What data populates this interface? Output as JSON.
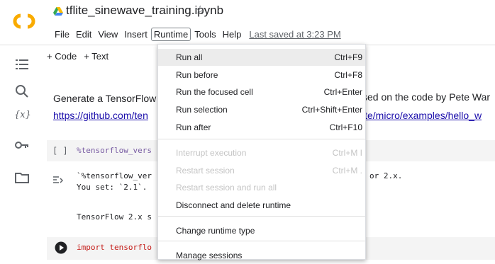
{
  "header": {
    "notebook_title": "tflite_sinewave_training.ipynb",
    "star_glyph": "☆",
    "menu": [
      "File",
      "Edit",
      "View",
      "Insert",
      "Runtime",
      "Tools",
      "Help"
    ],
    "active_menu": "Runtime",
    "last_saved": "Last saved at 3:23 PM"
  },
  "rail": {
    "variables_label": "{x}"
  },
  "toolbar": {
    "code_btn": "+ Code",
    "text_btn": "+ Text"
  },
  "content": {
    "text_line1": "Generate a TensorFlow",
    "link_line": "https://github.com/ten",
    "right_text": "sed on the code by Pete War",
    "right_link": "ite/micro/examples/hello_w",
    "cell1_bracket": "[ ]",
    "cell1_code": "%tensorflow_vers",
    "out_line1": "`%tensorflow_ver",
    "out_line2": "You set: `2.1`. ",
    "out_right": "or 2.x.",
    "out_line3": "TensorFlow 2.x s",
    "cell2_code1": "import tensorflo"
  },
  "runtime_menu": {
    "items": [
      {
        "label": "Run all",
        "shortcut": "Ctrl+F9",
        "disabled": false,
        "highlighted": true
      },
      {
        "label": "Run before",
        "shortcut": "Ctrl+F8",
        "disabled": false,
        "highlighted": false
      },
      {
        "label": "Run the focused cell",
        "shortcut": "Ctrl+Enter",
        "disabled": false,
        "highlighted": false
      },
      {
        "label": "Run selection",
        "shortcut": "Ctrl+Shift+Enter",
        "disabled": false,
        "highlighted": false
      },
      {
        "label": "Run after",
        "shortcut": "Ctrl+F10",
        "disabled": false,
        "highlighted": false
      },
      {
        "label": "Interrupt execution",
        "shortcut": "Ctrl+M I",
        "disabled": true,
        "highlighted": false
      },
      {
        "label": "Restart session",
        "shortcut": "Ctrl+M .",
        "disabled": true,
        "highlighted": false
      },
      {
        "label": "Restart session and run all",
        "shortcut": "",
        "disabled": true,
        "highlighted": false
      },
      {
        "label": "Disconnect and delete runtime",
        "shortcut": "",
        "disabled": false,
        "highlighted": false
      },
      {
        "label": "Change runtime type",
        "shortcut": "",
        "disabled": false,
        "highlighted": false
      },
      {
        "label": "Manage sessions",
        "shortcut": "",
        "disabled": false,
        "highlighted": false
      }
    ]
  },
  "colors": {
    "logo_orange": "#f9ab00",
    "link_blue": "#1a0dab",
    "menu_highlight": "#ececec"
  }
}
